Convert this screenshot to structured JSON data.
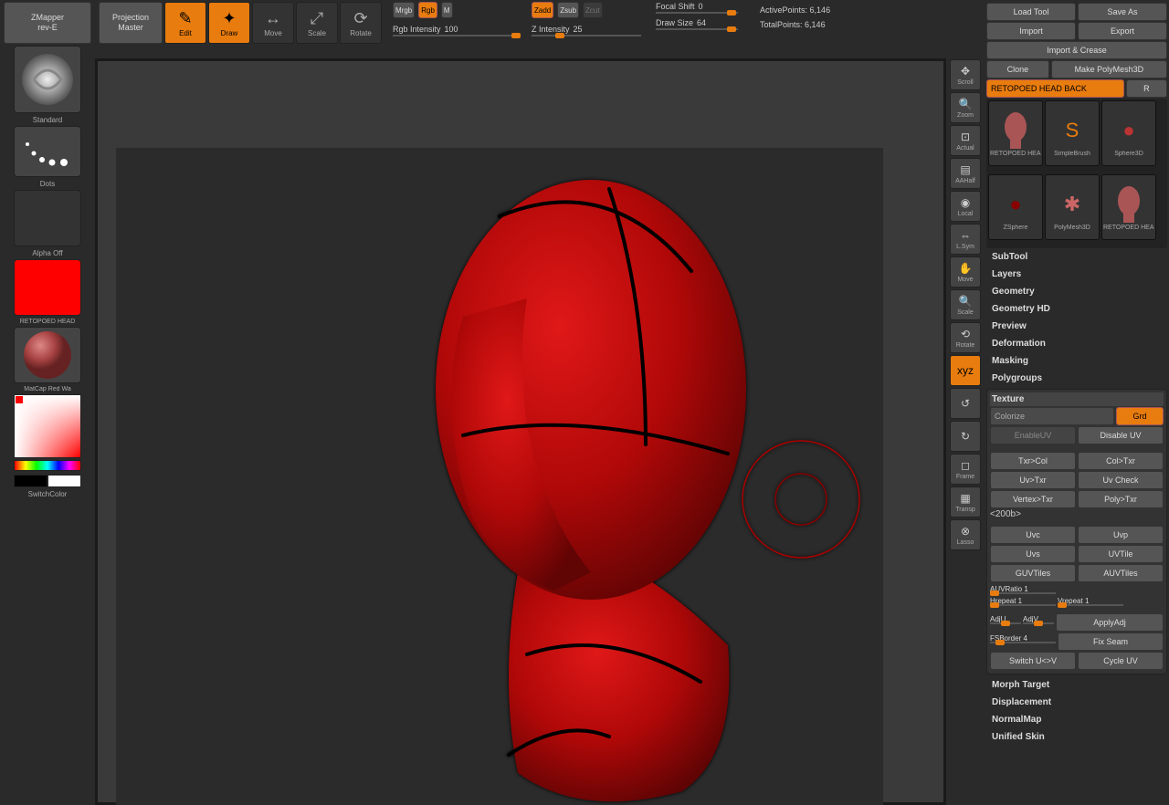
{
  "left": {
    "zmapper": "ZMapper\nrev-E",
    "projection_master": "Projection\nMaster",
    "brush_label": "Standard",
    "stroke_label": "Dots",
    "alpha_label": "Alpha Off",
    "texture_label": "RETOPOED HEAD",
    "material_label": "MatCap Red Wa",
    "switch_color": "SwitchColor"
  },
  "topbar": {
    "edit": "Edit",
    "draw": "Draw",
    "move": "Move",
    "scale": "Scale",
    "rotate": "Rotate",
    "mrgb": "Mrgb",
    "rgb": "Rgb",
    "m": "M",
    "zadd": "Zadd",
    "zsub": "Zsub",
    "zcut": "Zcut",
    "rgb_intensity_label": "Rgb Intensity",
    "rgb_intensity_value": "100",
    "z_intensity_label": "Z Intensity",
    "z_intensity_value": "25",
    "focal_shift_label": "Focal Shift",
    "focal_shift_value": "0",
    "draw_size_label": "Draw Size",
    "draw_size_value": "64",
    "active_points_label": "ActivePoints:",
    "active_points_value": "6,146",
    "total_points_label": "TotalPoints:",
    "total_points_value": "6,146"
  },
  "right_tools": [
    {
      "label": "Scroll",
      "icon": "scroll-icon"
    },
    {
      "label": "Zoom",
      "icon": "zoom-icon"
    },
    {
      "label": "Actual",
      "icon": "actual-icon"
    },
    {
      "label": "AAHalf",
      "icon": "aahalf-icon"
    },
    {
      "label": "Local",
      "icon": "local-icon"
    },
    {
      "label": "L.Sym",
      "icon": "lsym-icon"
    },
    {
      "label": "Move",
      "icon": "hand-icon"
    },
    {
      "label": "Scale",
      "icon": "magnify-icon"
    },
    {
      "label": "Rotate",
      "icon": "rotate-icon"
    },
    {
      "label": "",
      "icon": "xyz-icon",
      "orange": true,
      "text": "xyz"
    },
    {
      "label": "",
      "icon": "spin-icon"
    },
    {
      "label": "",
      "icon": "spin2-icon"
    },
    {
      "label": "Frame",
      "icon": "cube-icon"
    },
    {
      "label": "Transp",
      "icon": "transp-icon"
    },
    {
      "label": "Lasso",
      "icon": "lasso-icon"
    }
  ],
  "panel": {
    "load_tool": "Load Tool",
    "save_as": "Save As",
    "import": "Import",
    "export": "Export",
    "import_crease": "Import & Crease",
    "clone": "Clone",
    "make_polymesh": "Make PolyMesh3D",
    "current_tool": "RETOPOED HEAD BACK",
    "r_btn": "R",
    "tools": [
      "RETOPOED HEAD",
      "SimpleBrush",
      "Sphere3D",
      "ZSphere",
      "PolyMesh3D",
      "RETOPOED HEAD"
    ],
    "sections": [
      "SubTool",
      "Layers",
      "Geometry",
      "Geometry HD",
      "Preview",
      "Deformation",
      "Masking",
      "Polygroups"
    ],
    "texture_header": "Texture",
    "colorize": "Colorize",
    "grd": "Grd",
    "enable_uv": "EnableUV",
    "disable_uv": "Disable UV",
    "txrcol": "Txr>Col",
    "coltxr": "Col>Txr",
    "uvtxr": "Uv>Txr",
    "uvcheck": "Uv Check",
    "vertextxr": "Vertex>Txr",
    "polytxr": "Poly>Txr",
    "uvc": "Uvc",
    "uvp": "Uvp",
    "uvs": "Uvs",
    "uvtile": "UVTile",
    "guvtiles": "GUVTiles",
    "auvtiles": "AUVTiles",
    "auvratio": "AUVRatio 1",
    "hrepeat": "Hrepeat 1",
    "vrepeat": "Vrepeat 1",
    "adju": "AdjU",
    "adjv": "AdjV",
    "applyadj": "ApplyAdj",
    "fsborder": "FSBorder 4",
    "fixseam": "Fix Seam",
    "switchuv": "Switch U<>V",
    "cycleuv": "Cycle UV",
    "sections2": [
      "Morph Target",
      "Displacement",
      "NormalMap",
      "Unified Skin"
    ]
  }
}
